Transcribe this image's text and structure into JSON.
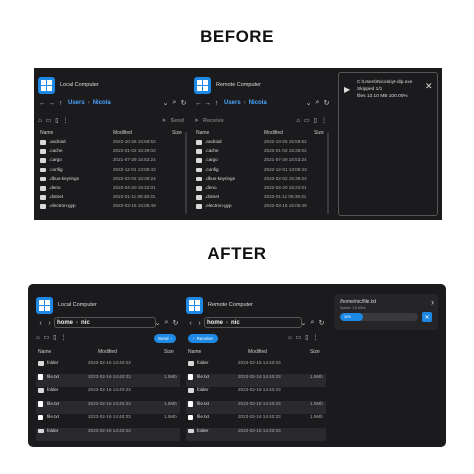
{
  "headings": {
    "before": "BEFORE",
    "after": "AFTER"
  },
  "before": {
    "local": {
      "title": "Local Computer",
      "crumbs": [
        "Users",
        "Nicola"
      ],
      "action": "Send",
      "columns": {
        "name": "Name",
        "modified": "Modified",
        "size": "Size"
      },
      "rows": [
        {
          "name": ".android",
          "modified": "2022-10-25 15:58:52"
        },
        {
          "name": ".cache",
          "modified": "2023-01-02 15:39:02"
        },
        {
          "name": ".cargo",
          "modified": "2021-07-29 15:53:24"
        },
        {
          "name": ".config",
          "modified": "2022-12-01 13:06:43"
        },
        {
          "name": ".dbus-keyrings",
          "modified": "2023-02-02 15:39:24"
        },
        {
          "name": ".deno",
          "modified": "2022-04-20 15:22:01"
        },
        {
          "name": ".dotnet",
          "modified": "2023-01-11 08:39:31"
        },
        {
          "name": ".electron-gyp",
          "modified": "2022-03-16 15:05:49"
        }
      ]
    },
    "remote": {
      "title": "Remote Computer",
      "crumbs": [
        "Users",
        "Nicola"
      ],
      "action": "Receive",
      "columns": {
        "name": "Name",
        "modified": "Modified",
        "size": "Size"
      },
      "rows": [
        {
          "name": ".android",
          "modified": "2022-10-25 15:58:52"
        },
        {
          "name": ".cache",
          "modified": "2023-01-02 15:39:02"
        },
        {
          "name": ".cargo",
          "modified": "2021-07-29 15:53:24"
        },
        {
          "name": ".config",
          "modified": "2022-12-01 13:06:43"
        },
        {
          "name": ".dbus-keyrings",
          "modified": "2023-02-02 15:39:24"
        },
        {
          "name": ".deno",
          "modified": "2022-04-20 15:22:01"
        },
        {
          "name": ".dotnet",
          "modified": "2023-01-11 08:39:31"
        },
        {
          "name": ".electron-gyp",
          "modified": "2022-03-16 15:05:49"
        }
      ]
    },
    "transfer": {
      "path": "C:\\Users\\Nicola\\yt-dlp.exe",
      "skipped": "Skipped 1/1",
      "files": "files 13.10 MB 100.00%"
    }
  },
  "after": {
    "local": {
      "title": "Local Computer",
      "crumbs": [
        "home",
        "nic"
      ],
      "action": "Send",
      "columns": {
        "name": "Name",
        "modified": "Modified",
        "size": "Size"
      },
      "rows": [
        {
          "type": "folder",
          "name": "folder",
          "modified": "2023-02-16 14:40:33",
          "size": ""
        },
        {
          "type": "file",
          "name": "file.txt",
          "modified": "2023-02-16 14:40:33",
          "size": "1.5Mb"
        },
        {
          "type": "folder",
          "name": "folder",
          "modified": "2023-02-16 14:40:33",
          "size": ""
        },
        {
          "type": "file",
          "name": "file.txt",
          "modified": "2023-02-16 14:40:33",
          "size": "1.5Mb"
        },
        {
          "type": "file",
          "name": "file.txt",
          "modified": "2023-02-16 14:40:33",
          "size": "1.5Mb"
        },
        {
          "type": "folder",
          "name": "folder",
          "modified": "2023-02-16 14:40:33",
          "size": ""
        }
      ]
    },
    "remote": {
      "title": "Remote Computer",
      "crumbs": [
        "home",
        "nic"
      ],
      "action": "Receive",
      "columns": {
        "name": "Name",
        "modified": "Modified",
        "size": "Size"
      },
      "rows": [
        {
          "type": "folder",
          "name": "folder",
          "modified": "2023-02-16 14:40:33",
          "size": ""
        },
        {
          "type": "file",
          "name": "file.txt",
          "modified": "2023-02-16 14:40:33",
          "size": "1.5Mb"
        },
        {
          "type": "folder",
          "name": "folder",
          "modified": "2023-02-16 14:40:33",
          "size": ""
        },
        {
          "type": "file",
          "name": "file.txt",
          "modified": "2023-02-16 14:40:33",
          "size": "1.5Mb"
        },
        {
          "type": "file",
          "name": "file.txt",
          "modified": "2023-02-16 14:40:33",
          "size": "1.5Mb"
        },
        {
          "type": "folder",
          "name": "folder",
          "modified": "2023-02-16 14:40:33",
          "size": ""
        }
      ]
    },
    "transfer": {
      "path": "/home/nic/file.txt",
      "speed": "Speed: 1.5 Mb/s",
      "progress_label": "30%",
      "progress": 0.3
    }
  },
  "colors": {
    "accent": "#1e88e5",
    "folder": "#d9d9d9",
    "background": "#1b1b1d"
  }
}
